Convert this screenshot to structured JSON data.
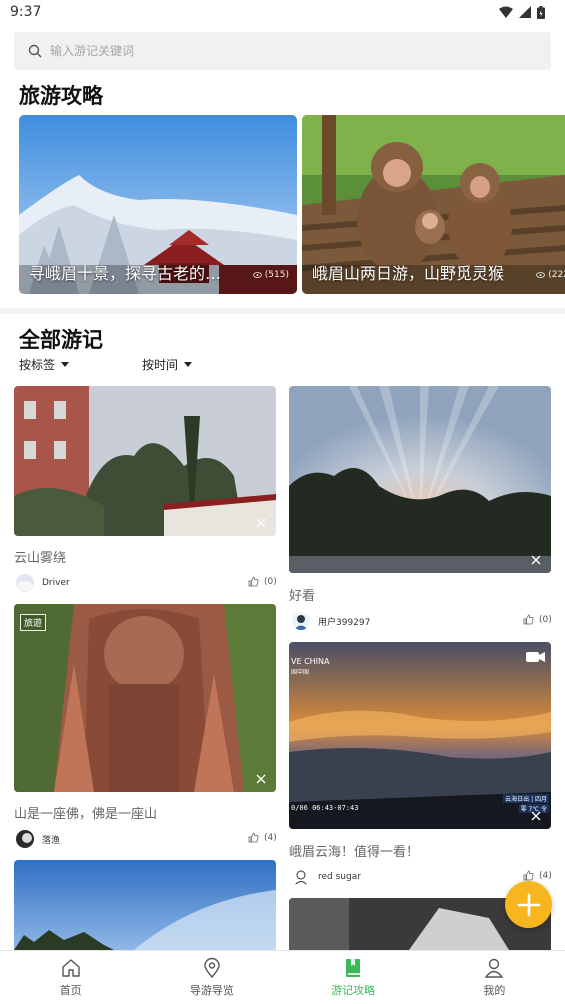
{
  "status_bar": {
    "time": "9:37"
  },
  "search": {
    "placeholder": "输入游记关键词"
  },
  "guides_section": {
    "title": "旅游攻略",
    "items": [
      {
        "caption": "寻峨眉十景，探寻古老的…",
        "views": "(515)"
      },
      {
        "caption": "峨眉山两日游，山野觅灵猴",
        "views": "(222"
      }
    ]
  },
  "notes_section": {
    "title": "全部游记",
    "filters": [
      "按标签",
      "按时间"
    ],
    "left_column": [
      {
        "title": "云山雾绕",
        "user": "Driver",
        "likes": "(0)",
        "tag": ""
      },
      {
        "title": "山是一座佛，佛是一座山",
        "user": "落渔",
        "likes": "(4)",
        "tag": "旅遊"
      }
    ],
    "right_column": [
      {
        "title": "好看",
        "user": "用户399297",
        "likes": "(0)"
      },
      {
        "title": "峨眉云海！值得一看！",
        "user": "red sugar",
        "likes": "(4)",
        "overlay_brand": "VE CHINA",
        "overlay_sub": "国中国",
        "overlay_time": "0/06 06:43-07:43",
        "overlay_stamp": "云海日出 | 四月",
        "overlay_temp": "零 7℃ 令"
      }
    ]
  },
  "bottom_nav": [
    {
      "label": "首页",
      "icon": "home-icon"
    },
    {
      "label": "导游导览",
      "icon": "location-pin-icon"
    },
    {
      "label": "游记攻略",
      "icon": "book-icon"
    },
    {
      "label": "我的",
      "icon": "user-icon"
    }
  ],
  "colors": {
    "accent_green": "#3cb85b",
    "fab_yellow": "#f7b61d"
  }
}
